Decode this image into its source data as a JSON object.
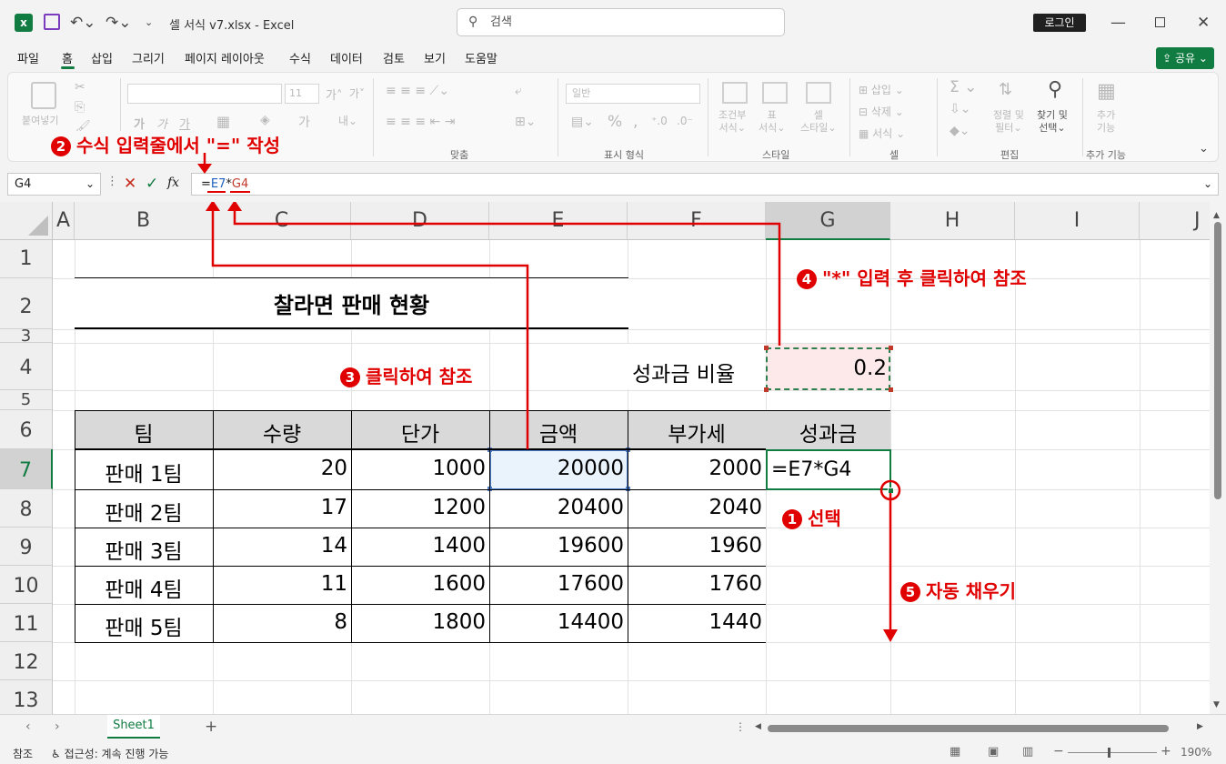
{
  "window": {
    "title": "셀 서식 v7.xlsx  -  Excel",
    "search_placeholder": "검색",
    "login_label": "로그인",
    "share_label": "공유"
  },
  "tabs": [
    "파일",
    "홈",
    "삽입",
    "그리기",
    "페이지 레이아웃",
    "수식",
    "데이터",
    "검토",
    "보기",
    "도움말"
  ],
  "ribbon": {
    "groups": [
      "클립보드",
      "맞춤",
      "표시 형식",
      "스타일",
      "셀",
      "편집",
      "추가 기능"
    ],
    "paste": "붙여넣기",
    "font_size": "11",
    "number_format": "일반",
    "cond_format": "조건부\n서식",
    "table_format": "표\n서식",
    "cell_style": "셀\n스타일",
    "insert": "삽입",
    "delete": "삭제",
    "format": "서식",
    "sort_filter": "정렬 및\n필터",
    "find_select": "찾기 및\n선택",
    "addins": "추가\n기능"
  },
  "formula_bar": {
    "name_box": "G4",
    "formula_prefix": "=",
    "formula_ref1": "E7",
    "formula_op": "*",
    "formula_ref2": "G4"
  },
  "columns": [
    "A",
    "B",
    "C",
    "D",
    "E",
    "F",
    "G",
    "H",
    "I",
    "J"
  ],
  "rows": [
    "1",
    "2",
    "3",
    "4",
    "5",
    "6",
    "7",
    "8",
    "9",
    "10",
    "11",
    "12",
    "13"
  ],
  "sheet": {
    "title": "찰라면 판매 현황",
    "ratio_label": "성과금 비율",
    "ratio_value": "0.2",
    "headers": [
      "팀",
      "수량",
      "단가",
      "금액",
      "부가세",
      "성과금"
    ],
    "data": [
      [
        "판매 1팀",
        "20",
        "1000",
        "20000",
        "2000",
        "=E7*G4"
      ],
      [
        "판매 2팀",
        "17",
        "1200",
        "20400",
        "2040",
        ""
      ],
      [
        "판매 3팀",
        "14",
        "1400",
        "19600",
        "1960",
        ""
      ],
      [
        "판매 4팀",
        "11",
        "1600",
        "17600",
        "1760",
        ""
      ],
      [
        "판매 5팀",
        "8",
        "1800",
        "14400",
        "1440",
        ""
      ]
    ]
  },
  "annotations": {
    "a1": {
      "num": "1",
      "text": "선택"
    },
    "a2": {
      "num": "2",
      "text": "수식 입력줄에서 \"=\" 작성"
    },
    "a3": {
      "num": "3",
      "text": "클릭하여 참조"
    },
    "a4": {
      "num": "4",
      "text": "\"*\" 입력 후 클릭하여 참조"
    },
    "a5": {
      "num": "5",
      "text": "자동 채우기"
    }
  },
  "sheet_tabs": [
    "Sheet1"
  ],
  "status": {
    "mode": "참조",
    "accessibility": "접근성: 계속 진행 가능",
    "zoom": "190%"
  },
  "colors": {
    "accent": "#107c41",
    "annotation": "#e00000",
    "ref_blue": "#1f5fbf",
    "header_fill": "#d9d9d9"
  }
}
